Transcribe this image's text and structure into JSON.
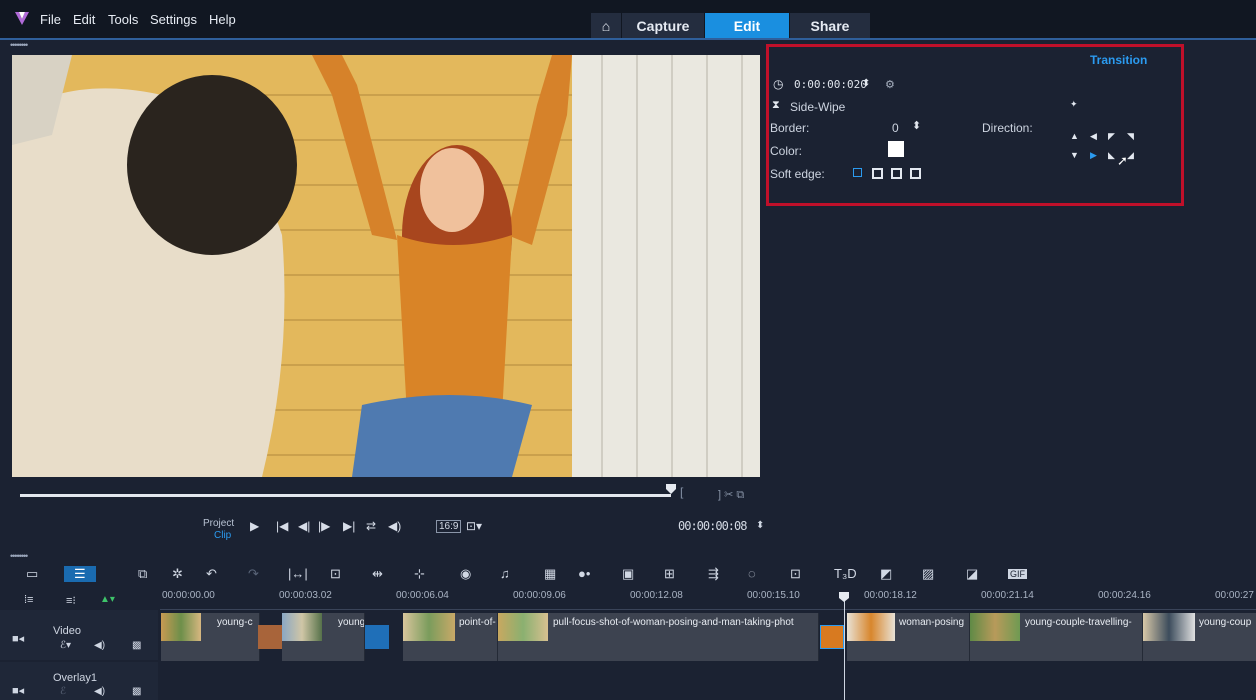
{
  "menu": {
    "items": [
      "File",
      "Edit",
      "Tools",
      "Settings",
      "Help"
    ]
  },
  "mode_tabs": {
    "home_icon": "home-icon",
    "capture": "Capture",
    "edit": "Edit",
    "share": "Share"
  },
  "colors": {
    "accent": "#1a8fe0",
    "highlight": "#c0102a",
    "panel_bg": "#1b2232"
  },
  "player": {
    "project_label": "Project",
    "clip_label": "Clip",
    "timecode": "00:00:00:08",
    "aspect_label": "16:9",
    "progress": 0.88
  },
  "options": {
    "title": "Transition",
    "duration": "0:00:00:020",
    "effect_name": "Side-Wipe",
    "border_label": "Border:",
    "border_value": "0",
    "direction_label": "Direction:",
    "color_label": "Color:",
    "color_value": "#ffffff",
    "soft_edge_label": "Soft edge:"
  },
  "timeline": {
    "ruler": [
      "00:00:00.00",
      "00:00:03.02",
      "00:00:06.04",
      "00:00:09.06",
      "00:00:12.08",
      "00:00:15.10",
      "00:00:18.12",
      "00:00:21.14",
      "00:00:24.16",
      "00:00:27"
    ],
    "tracks": [
      {
        "name": "Video"
      },
      {
        "name": "Overlay1"
      }
    ],
    "clips": [
      {
        "title": "young-c"
      },
      {
        "title": "young"
      },
      {
        "title": "point-of-"
      },
      {
        "title": "pull-focus-shot-of-woman-posing-and-man-taking-phot"
      },
      {
        "title": "woman-posing"
      },
      {
        "title": "young-couple-travelling-"
      },
      {
        "title": "young-coup"
      }
    ]
  }
}
